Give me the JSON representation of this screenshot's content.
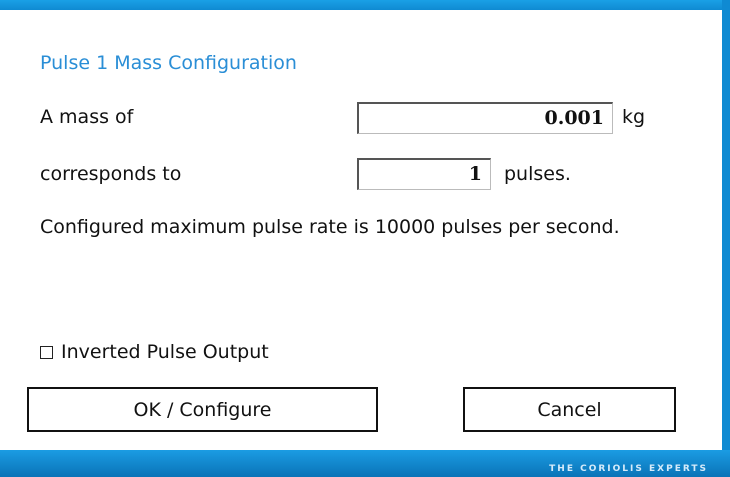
{
  "dialog": {
    "title": "Pulse 1 Mass Configuration",
    "mass_label": "A mass of",
    "mass_value": "0.001",
    "mass_unit": "kg",
    "corresponds_label": "corresponds to",
    "pulses_value": "1",
    "pulses_unit": "pulses.",
    "info_text": "Configured maximum pulse rate is 10000 pulses per second.",
    "inverted_label": "Inverted Pulse Output",
    "inverted_checked": false,
    "ok_button": "OK / Configure",
    "cancel_button": "Cancel"
  },
  "footer": {
    "tagline": "THE CORIOLIS EXPERTS"
  },
  "colors": {
    "frame": "#0f8ad2",
    "title": "#2a8ed6"
  }
}
